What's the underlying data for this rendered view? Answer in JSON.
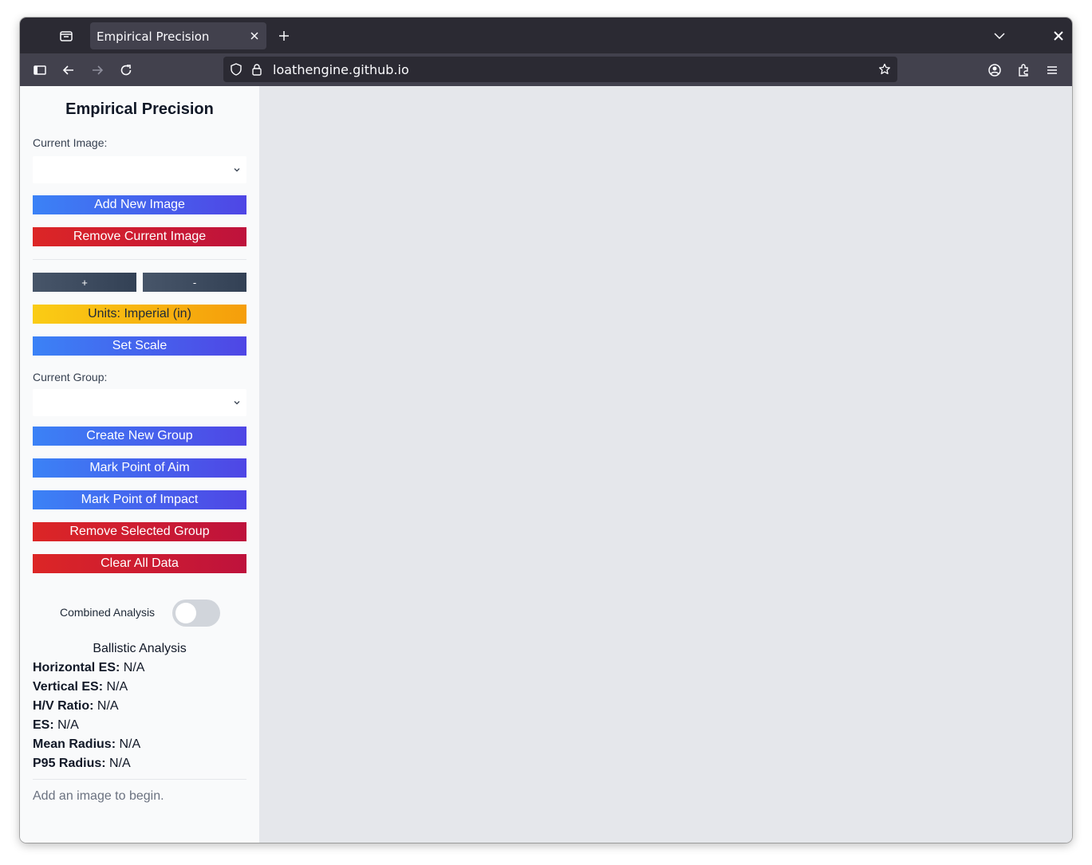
{
  "browser": {
    "tab_title": "Empirical Precision",
    "url": "loathengine.github.io"
  },
  "sidebar": {
    "title": "Empirical Precision",
    "current_image_label": "Current Image:",
    "current_image_value": "",
    "add_image": "Add New Image",
    "remove_image": "Remove Current Image",
    "zoom_in": "+",
    "zoom_out": "-",
    "units": "Units: Imperial (in)",
    "set_scale": "Set Scale",
    "current_group_label": "Current Group:",
    "current_group_value": "",
    "create_group": "Create New Group",
    "mark_aim": "Mark Point of Aim",
    "mark_impact": "Mark Point of Impact",
    "remove_group": "Remove Selected Group",
    "clear_all": "Clear All Data",
    "combined_label": "Combined Analysis",
    "combined_on": false
  },
  "analysis": {
    "title": "Ballistic Analysis",
    "stats": [
      {
        "label": "Horizontal ES:",
        "value": "N/A"
      },
      {
        "label": "Vertical ES:",
        "value": "N/A"
      },
      {
        "label": "H/V Ratio:",
        "value": "N/A"
      },
      {
        "label": "ES:",
        "value": "N/A"
      },
      {
        "label": "Mean Radius:",
        "value": "N/A"
      },
      {
        "label": "P95 Radius:",
        "value": "N/A"
      }
    ]
  },
  "hint": "Add an image to begin."
}
